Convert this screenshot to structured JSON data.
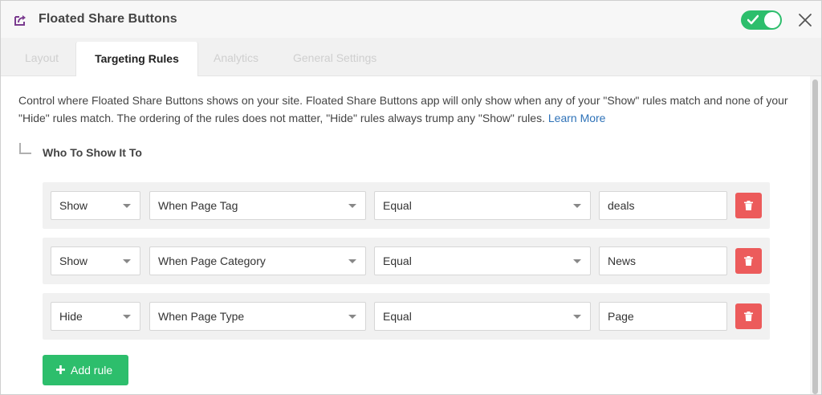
{
  "window": {
    "title": "Floated Share Buttons",
    "app_icon": "share-out-icon",
    "enabled": true,
    "accent_color": "#2dbe6c"
  },
  "tabs": [
    {
      "label": "Layout",
      "active": false
    },
    {
      "label": "Targeting Rules",
      "active": true
    },
    {
      "label": "Analytics",
      "active": false
    },
    {
      "label": "General Settings",
      "active": false
    }
  ],
  "description": {
    "text": "Control where Floated Share Buttons shows on your site. Floated Share Buttons app will only show when any of your \"Show\" rules match and none of your \"Hide\" rules match. The ordering of the rules does not matter, \"Hide\" rules always trump any \"Show\" rules.",
    "link": "Learn More"
  },
  "section_title": "Who To Show It To",
  "rules": [
    {
      "action": "Show",
      "condition": "When Page Tag",
      "operator": "Equal",
      "value": "deals"
    },
    {
      "action": "Show",
      "condition": "When Page Category",
      "operator": "Equal",
      "value": "News"
    },
    {
      "action": "Hide",
      "condition": "When Page Type",
      "operator": "Equal",
      "value": "Page"
    }
  ],
  "add_rule_label": "Add rule",
  "delete_color": "#ec5b5b"
}
